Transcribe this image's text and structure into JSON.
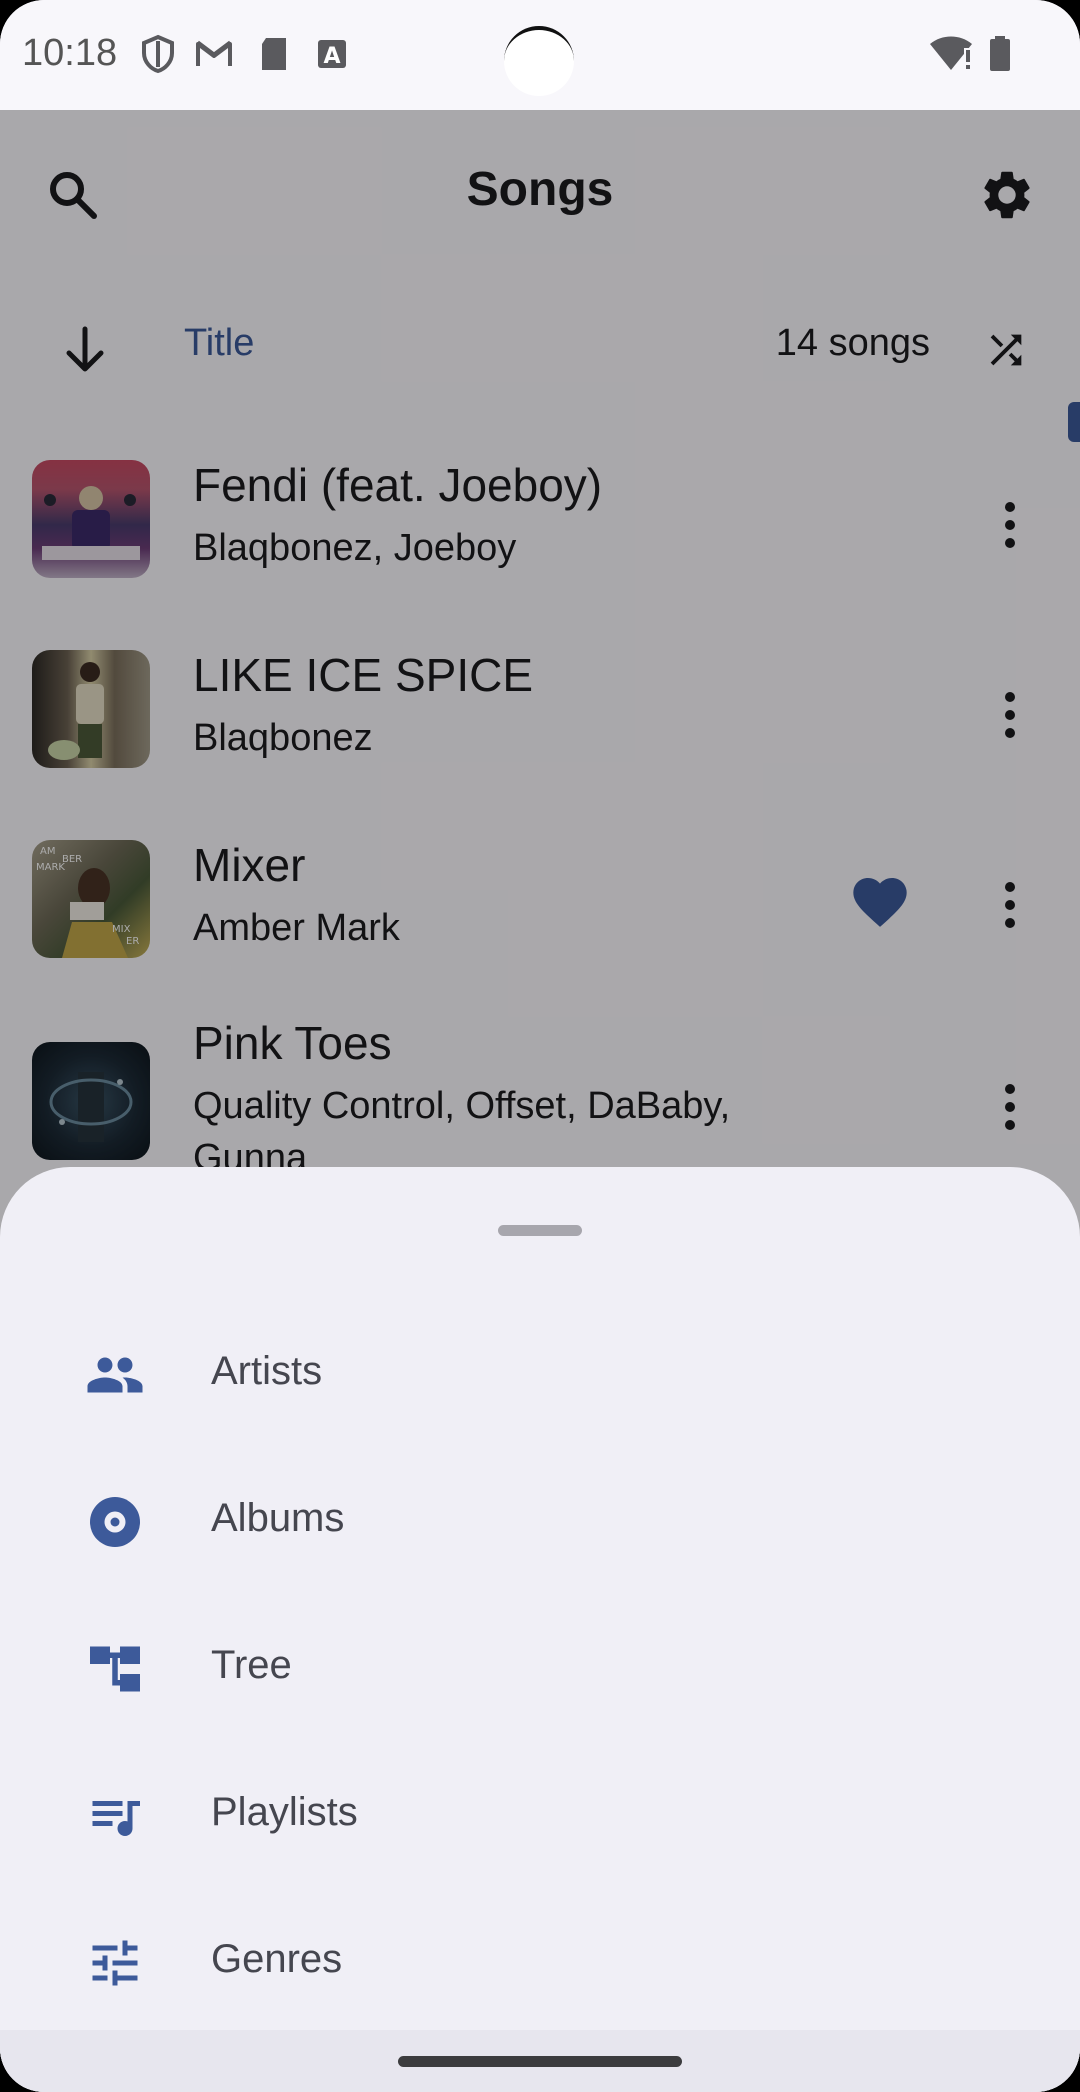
{
  "status_bar": {
    "time": "10:18",
    "icons": [
      "shield-icon",
      "gmail-icon",
      "sd-card-icon",
      "font-icon",
      "wifi-alert-icon",
      "battery-icon"
    ]
  },
  "header": {
    "title": "Songs",
    "search_icon": "search-icon",
    "settings_icon": "gear-icon"
  },
  "sort_bar": {
    "direction_icon": "arrow-down-icon",
    "sort_by": "Title",
    "count": "14 songs",
    "shuffle_icon": "shuffle-icon"
  },
  "songs": [
    {
      "title": "Fendi (feat. Joeboy)",
      "artist": "Blaqbonez, Joeboy",
      "favorite": false
    },
    {
      "title": "LIKE ICE SPICE",
      "artist": "Blaqbonez",
      "favorite": false
    },
    {
      "title": "Mixer",
      "artist": "Amber Mark",
      "favorite": true
    },
    {
      "title": "Pink Toes",
      "artist": "Quality Control, Offset, DaBaby, Gunna",
      "favorite": false
    }
  ],
  "sheet": {
    "items": [
      {
        "label": "Artists",
        "icon": "artists-icon"
      },
      {
        "label": "Albums",
        "icon": "album-icon"
      },
      {
        "label": "Tree",
        "icon": "tree-icon"
      },
      {
        "label": "Playlists",
        "icon": "playlist-icon"
      },
      {
        "label": "Genres",
        "icon": "genres-icon"
      }
    ]
  },
  "colors": {
    "accent": "#3d5a9a",
    "sheet_bg": "#f0eff6",
    "text": "#1b1b1f"
  }
}
